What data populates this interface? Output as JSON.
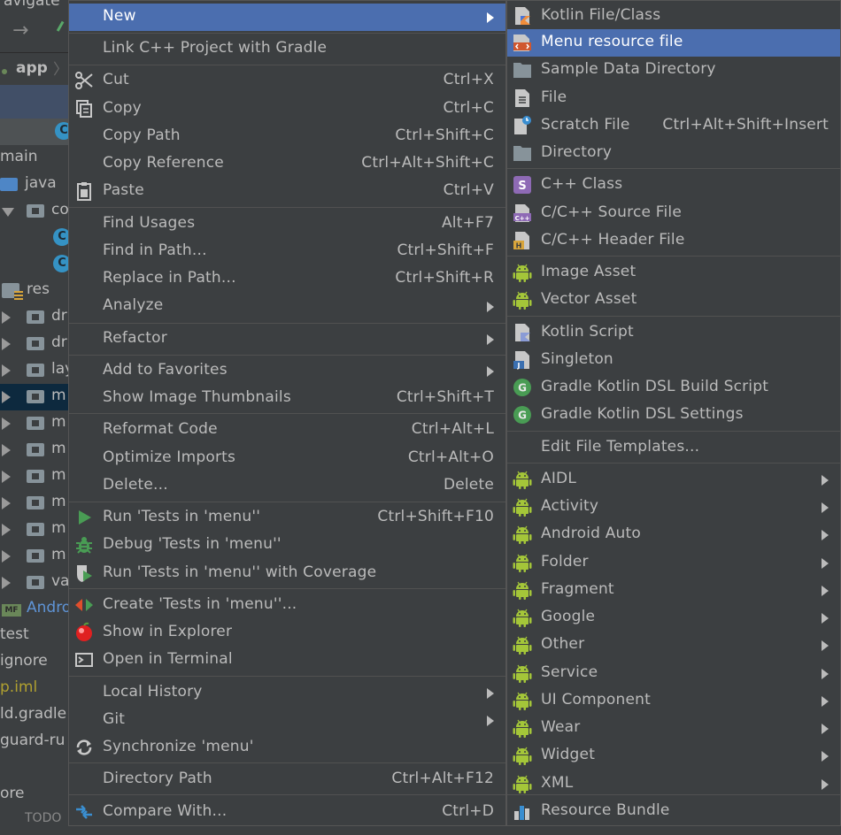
{
  "ide": {
    "menu_bar_text": "avigate",
    "breadcrumb": "app",
    "tree": [
      {
        "label": "",
        "icon": "class"
      },
      {
        "label": "main",
        "icon": "none"
      },
      {
        "label": "java",
        "icon": "folder-blue"
      },
      {
        "label": "co",
        "icon": "folder"
      },
      {
        "label": "",
        "icon": "class"
      },
      {
        "label": "",
        "icon": "class"
      },
      {
        "label": "res",
        "icon": "res"
      },
      {
        "label": "dr",
        "icon": "folder"
      },
      {
        "label": "dr",
        "icon": "folder"
      },
      {
        "label": "lay",
        "icon": "folder"
      },
      {
        "label": "m",
        "icon": "folder"
      },
      {
        "label": "m",
        "icon": "folder"
      },
      {
        "label": "m",
        "icon": "folder"
      },
      {
        "label": "m",
        "icon": "folder"
      },
      {
        "label": "m",
        "icon": "folder"
      },
      {
        "label": "m",
        "icon": "folder"
      },
      {
        "label": "m",
        "icon": "folder"
      },
      {
        "label": "va",
        "icon": "folder"
      },
      {
        "label": "Andro",
        "icon": "manifest"
      },
      {
        "label": "test",
        "icon": "none"
      },
      {
        "label": "ignore",
        "icon": "none"
      },
      {
        "label": "p.iml",
        "icon": "none"
      },
      {
        "label": "ld.gradle",
        "icon": "none"
      },
      {
        "label": "guard-ru",
        "icon": "none"
      },
      {
        "label": "ore",
        "icon": "none"
      },
      {
        "label": "TODO",
        "icon": "none"
      }
    ]
  },
  "context_menu": {
    "items": [
      {
        "label": "New",
        "shortcut": "",
        "submenu": true,
        "icon": "none",
        "selected": true
      },
      {
        "label": "Link C++ Project with Gradle",
        "shortcut": "",
        "submenu": false,
        "icon": "none"
      },
      {
        "label": "Cut",
        "shortcut": "Ctrl+X",
        "submenu": false,
        "icon": "scissors-icon"
      },
      {
        "label": "Copy",
        "shortcut": "Ctrl+C",
        "submenu": false,
        "icon": "copy-icon"
      },
      {
        "label": "Copy Path",
        "shortcut": "Ctrl+Shift+C",
        "submenu": false,
        "icon": "none"
      },
      {
        "label": "Copy Reference",
        "shortcut": "Ctrl+Alt+Shift+C",
        "submenu": false,
        "icon": "none"
      },
      {
        "label": "Paste",
        "shortcut": "Ctrl+V",
        "submenu": false,
        "icon": "clipboard-icon"
      },
      {
        "label": "Find Usages",
        "shortcut": "Alt+F7",
        "submenu": false,
        "icon": "none"
      },
      {
        "label": "Find in Path...",
        "shortcut": "Ctrl+Shift+F",
        "submenu": false,
        "icon": "none"
      },
      {
        "label": "Replace in Path...",
        "shortcut": "Ctrl+Shift+R",
        "submenu": false,
        "icon": "none"
      },
      {
        "label": "Analyze",
        "shortcut": "",
        "submenu": true,
        "icon": "none"
      },
      {
        "label": "Refactor",
        "shortcut": "",
        "submenu": true,
        "icon": "none"
      },
      {
        "label": "Add to Favorites",
        "shortcut": "",
        "submenu": true,
        "icon": "none"
      },
      {
        "label": "Show Image Thumbnails",
        "shortcut": "Ctrl+Shift+T",
        "submenu": false,
        "icon": "none"
      },
      {
        "label": "Reformat Code",
        "shortcut": "Ctrl+Alt+L",
        "submenu": false,
        "icon": "none"
      },
      {
        "label": "Optimize Imports",
        "shortcut": "Ctrl+Alt+O",
        "submenu": false,
        "icon": "none"
      },
      {
        "label": "Delete...",
        "shortcut": "Delete",
        "submenu": false,
        "icon": "none"
      },
      {
        "label": "Run 'Tests in 'menu''",
        "shortcut": "Ctrl+Shift+F10",
        "submenu": false,
        "icon": "run-icon"
      },
      {
        "label": "Debug 'Tests in 'menu''",
        "shortcut": "",
        "submenu": false,
        "icon": "debug-icon"
      },
      {
        "label": "Run 'Tests in 'menu'' with Coverage",
        "shortcut": "",
        "submenu": false,
        "icon": "coverage-icon"
      },
      {
        "label": "Create 'Tests in 'menu''...",
        "shortcut": "",
        "submenu": false,
        "icon": "create-test-icon"
      },
      {
        "label": "Show in Explorer",
        "shortcut": "",
        "submenu": false,
        "icon": "explorer-icon"
      },
      {
        "label": "Open in Terminal",
        "shortcut": "",
        "submenu": false,
        "icon": "terminal-icon"
      },
      {
        "label": "Local History",
        "shortcut": "",
        "submenu": true,
        "icon": "none"
      },
      {
        "label": "Git",
        "shortcut": "",
        "submenu": true,
        "icon": "none"
      },
      {
        "label": "Synchronize 'menu'",
        "shortcut": "",
        "submenu": false,
        "icon": "sync-icon"
      },
      {
        "label": "Directory Path",
        "shortcut": "Ctrl+Alt+F12",
        "submenu": false,
        "icon": "none"
      },
      {
        "label": "Compare With...",
        "shortcut": "Ctrl+D",
        "submenu": false,
        "icon": "compare-icon"
      }
    ]
  },
  "new_submenu": {
    "items": [
      {
        "label": "Kotlin File/Class",
        "shortcut": "",
        "submenu": false,
        "icon": "kotlin-file-icon"
      },
      {
        "label": "Menu resource file",
        "shortcut": "",
        "submenu": false,
        "icon": "menu-resource-icon",
        "selected": true
      },
      {
        "label": "Sample Data Directory",
        "shortcut": "",
        "submenu": false,
        "icon": "folder-icon"
      },
      {
        "label": "File",
        "shortcut": "",
        "submenu": false,
        "icon": "file-icon"
      },
      {
        "label": "Scratch File",
        "shortcut": "Ctrl+Alt+Shift+Insert",
        "submenu": false,
        "icon": "scratch-file-icon"
      },
      {
        "label": "Directory",
        "shortcut": "",
        "submenu": false,
        "icon": "folder-icon"
      },
      {
        "label": "C++ Class",
        "shortcut": "",
        "submenu": false,
        "icon": "cpp-class-icon"
      },
      {
        "label": "C/C++ Source File",
        "shortcut": "",
        "submenu": false,
        "icon": "cpp-source-icon"
      },
      {
        "label": "C/C++ Header File",
        "shortcut": "",
        "submenu": false,
        "icon": "cpp-header-icon"
      },
      {
        "label": "Image Asset",
        "shortcut": "",
        "submenu": false,
        "icon": "android-icon"
      },
      {
        "label": "Vector Asset",
        "shortcut": "",
        "submenu": false,
        "icon": "android-icon"
      },
      {
        "label": "Kotlin Script",
        "shortcut": "",
        "submenu": false,
        "icon": "kotlin-script-icon"
      },
      {
        "label": "Singleton",
        "shortcut": "",
        "submenu": false,
        "icon": "singleton-icon"
      },
      {
        "label": "Gradle Kotlin DSL Build Script",
        "shortcut": "",
        "submenu": false,
        "icon": "gradle-icon"
      },
      {
        "label": "Gradle Kotlin DSL Settings",
        "shortcut": "",
        "submenu": false,
        "icon": "gradle-icon"
      },
      {
        "label": "Edit File Templates...",
        "shortcut": "",
        "submenu": false,
        "icon": "none"
      },
      {
        "label": "AIDL",
        "shortcut": "",
        "submenu": true,
        "icon": "android-icon"
      },
      {
        "label": "Activity",
        "shortcut": "",
        "submenu": true,
        "icon": "android-icon"
      },
      {
        "label": "Android Auto",
        "shortcut": "",
        "submenu": true,
        "icon": "android-icon"
      },
      {
        "label": "Folder",
        "shortcut": "",
        "submenu": true,
        "icon": "android-icon"
      },
      {
        "label": "Fragment",
        "shortcut": "",
        "submenu": true,
        "icon": "android-icon"
      },
      {
        "label": "Google",
        "shortcut": "",
        "submenu": true,
        "icon": "android-icon"
      },
      {
        "label": "Other",
        "shortcut": "",
        "submenu": true,
        "icon": "android-icon"
      },
      {
        "label": "Service",
        "shortcut": "",
        "submenu": true,
        "icon": "android-icon"
      },
      {
        "label": "UI Component",
        "shortcut": "",
        "submenu": true,
        "icon": "android-icon"
      },
      {
        "label": "Wear",
        "shortcut": "",
        "submenu": true,
        "icon": "android-icon"
      },
      {
        "label": "Widget",
        "shortcut": "",
        "submenu": true,
        "icon": "android-icon"
      },
      {
        "label": "XML",
        "shortcut": "",
        "submenu": true,
        "icon": "android-icon"
      },
      {
        "label": "Resource Bundle",
        "shortcut": "",
        "submenu": false,
        "icon": "resource-bundle-icon"
      }
    ]
  },
  "colors": {
    "background": "#3c3f41",
    "selection": "#4b6eaf",
    "text": "#bbbbbb",
    "android_green": "#a4c639"
  }
}
